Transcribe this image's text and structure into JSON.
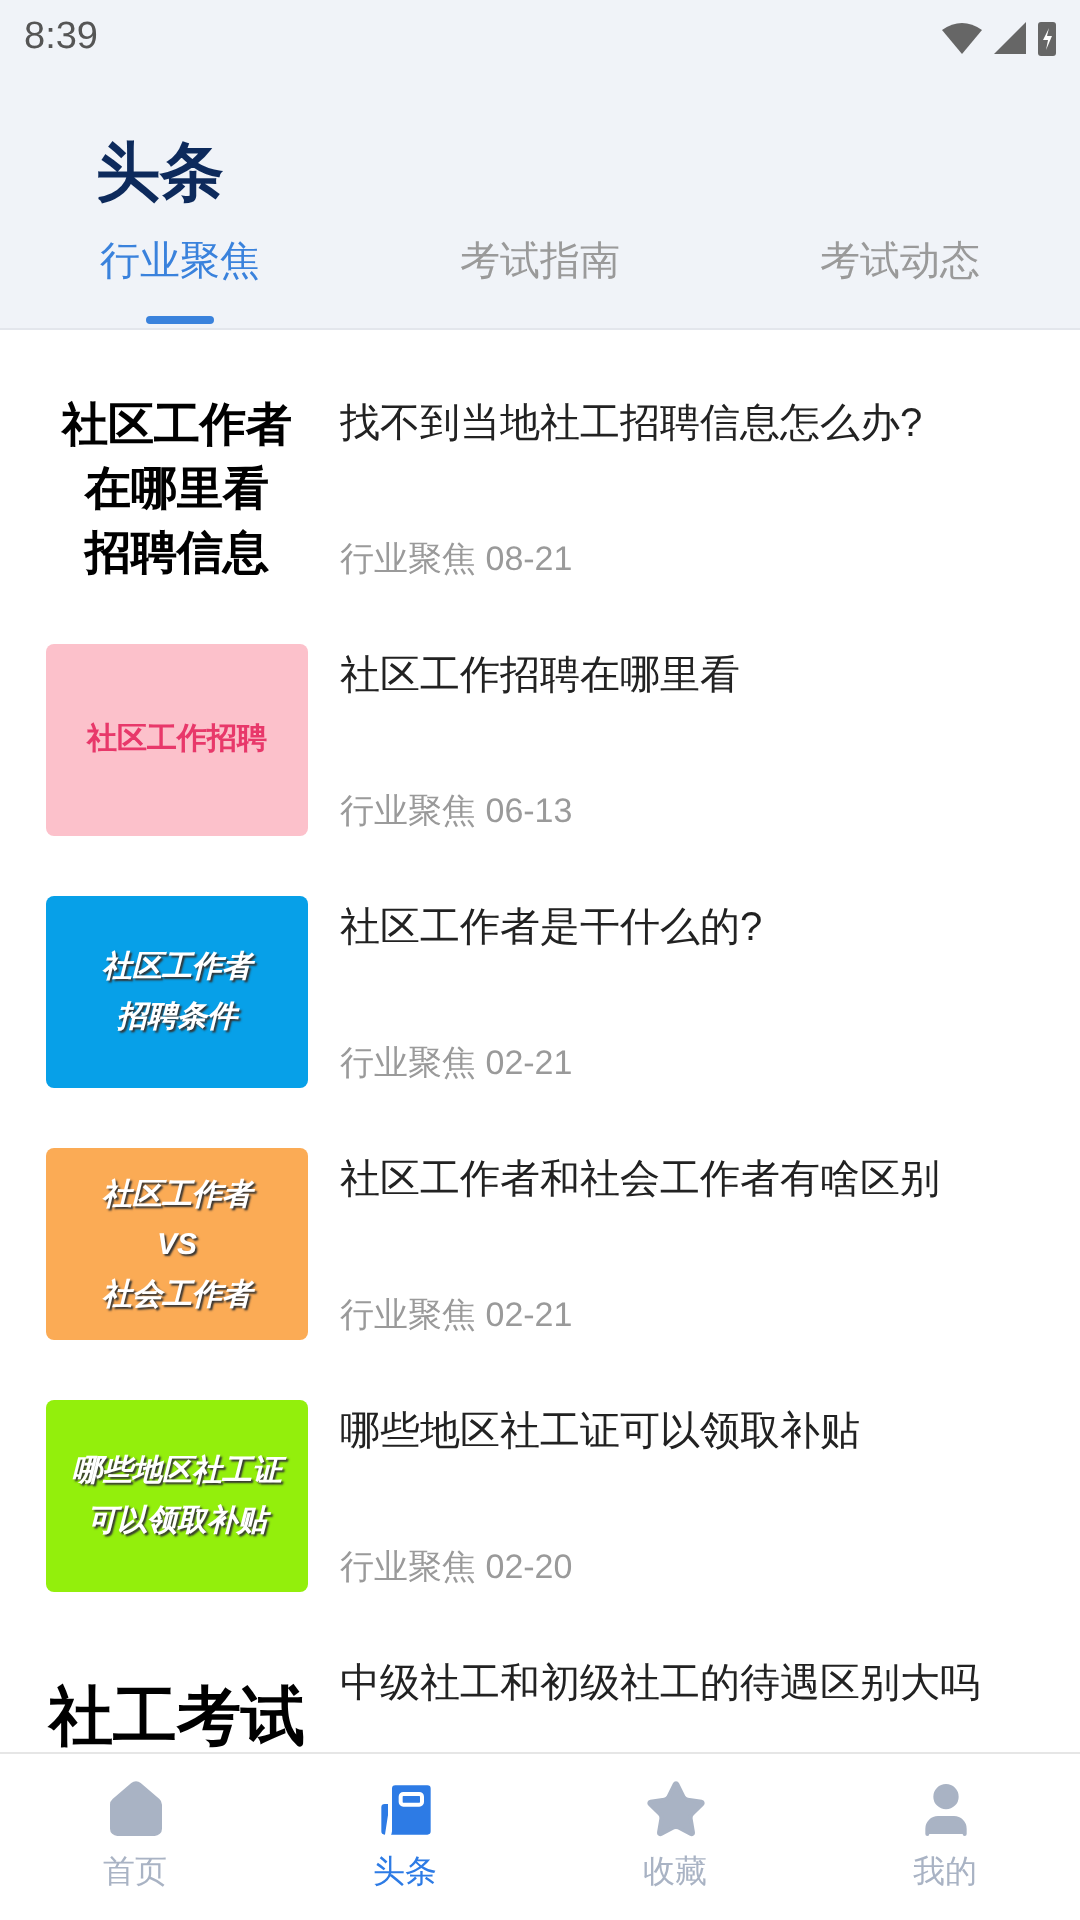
{
  "status_bar": {
    "time": "8:39"
  },
  "header": {
    "title": "头条"
  },
  "tabs": [
    {
      "label": "行业聚焦",
      "selected": true
    },
    {
      "label": "考试指南",
      "selected": false
    },
    {
      "label": "考试动态",
      "selected": false
    }
  ],
  "articles": [
    {
      "title": "找不到当地社工招聘信息怎么办?",
      "category": "行业聚焦",
      "date": "08-21",
      "thumbnail": {
        "kind": "plain",
        "lines": [
          "社区工作者",
          "在哪里看",
          "招聘信息"
        ]
      }
    },
    {
      "title": "社区工作招聘在哪里看",
      "category": "行业聚焦",
      "date": "06-13",
      "thumbnail": {
        "kind": "red",
        "color": "#fcc1cb",
        "lines": [
          "社区工作招聘"
        ]
      }
    },
    {
      "title": "社区工作者是干什么的?",
      "category": "行业聚焦",
      "date": "02-21",
      "thumbnail": {
        "kind": "italic",
        "color": "#07a0e8",
        "lines": [
          "社区工作者",
          "招聘条件"
        ]
      }
    },
    {
      "title": "社区工作者和社会工作者有啥区别",
      "category": "行业聚焦",
      "date": "02-21",
      "thumbnail": {
        "kind": "italic",
        "color": "#fbab55",
        "lines": [
          "社区工作者",
          "VS",
          "社会工作者"
        ]
      }
    },
    {
      "title": "哪些地区社工证可以领取补贴",
      "category": "行业聚焦",
      "date": "02-20",
      "thumbnail": {
        "kind": "italic",
        "color": "#93ef0c",
        "lines": [
          "哪些地区社工证",
          "可以领取补贴"
        ]
      }
    },
    {
      "title": "中级社工和初级社工的待遇区别大吗",
      "thumbnail": {
        "kind": "plain",
        "lines": [
          "社工考试"
        ]
      }
    }
  ],
  "bottom_nav": [
    {
      "label": "首页",
      "kind": "home",
      "selected": false
    },
    {
      "label": "头条",
      "kind": "news",
      "selected": true
    },
    {
      "label": "收藏",
      "kind": "star",
      "selected": false
    },
    {
      "label": "我的",
      "kind": "user",
      "selected": false
    }
  ]
}
